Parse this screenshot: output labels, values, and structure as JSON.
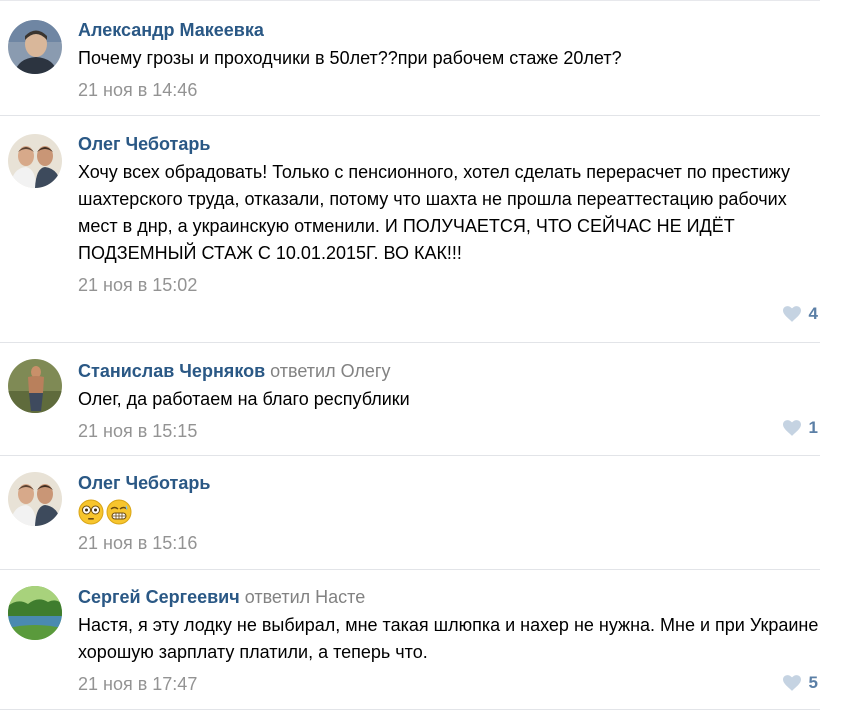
{
  "comments": [
    {
      "author": "Александр Макеевка",
      "reply_to": "",
      "text": "Почему грозы и проходчики в 50лет??при рабочем стаже 20лет?",
      "date": "21 ноя в 14:46",
      "likes": ""
    },
    {
      "author": "Олег Чеботарь",
      "reply_to": "",
      "text": "Хочу всех обрадовать! Только с пенсионного, хотел сделать перерасчет по престижу шахтерского труда, отказали, потому что шахта не прошла переаттестацию рабочих мест в днр, а украинскую отменили. И ПОЛУЧАЕТСЯ, ЧТО СЕЙЧАС НЕ ИДЁТ ПОДЗЕМНЫЙ СТАЖ С 10.01.2015Г. ВО КАК!!!",
      "date": "21 ноя в 15:02",
      "likes": "4"
    },
    {
      "author": "Станислав Черняков",
      "reply_to": "ответил Олегу",
      "text": "Олег, да работаем на благо республики",
      "date": "21 ноя в 15:15",
      "likes": "1"
    },
    {
      "author": "Олег Чеботарь",
      "reply_to": "",
      "emojis": [
        "flushed-face-emoji",
        "grimacing-face-emoji"
      ],
      "date": "21 ноя в 15:16",
      "likes": ""
    },
    {
      "author": "Сергей Сергеевич",
      "reply_to": "ответил Насте",
      "text": "Настя, я эту лодку не выбирал, мне такая шлюпка и нахер не нужна. Мне и при Украине хорошую зарплату платили, а теперь что.",
      "date": "21 ноя в 17:47",
      "likes": "5"
    }
  ],
  "colors": {
    "author_link": "#2a5885",
    "meta_grey": "#939393",
    "like_heart": "#c5d3e2",
    "like_count": "#5b7fa6",
    "divider": "#e2e4e8"
  },
  "icons": {
    "like": "heart-icon"
  }
}
